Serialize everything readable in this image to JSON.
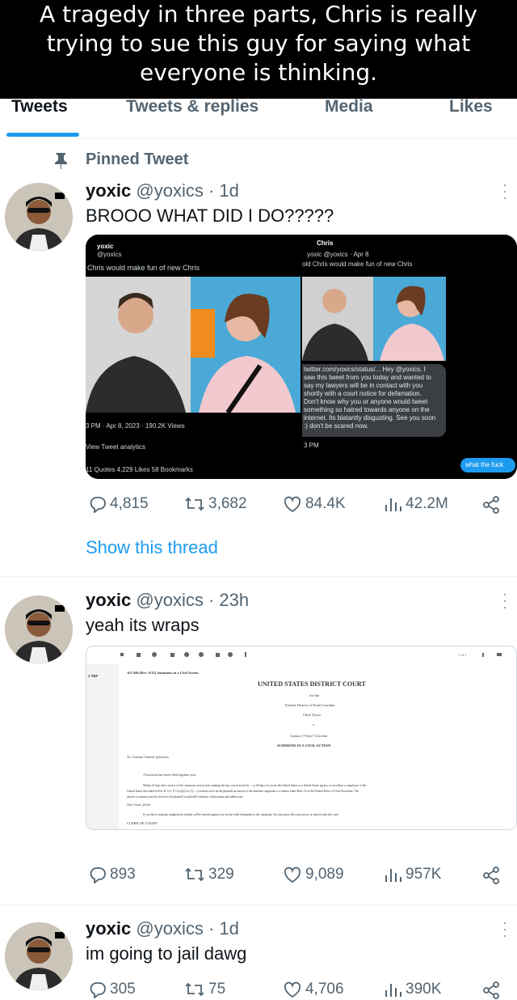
{
  "caption": {
    "lines": [
      "A tragedy in three parts, Chris is really",
      "trying to sue this guy for saying what",
      "everyone is thinking."
    ]
  },
  "tabs": [
    {
      "label": "Tweets",
      "active": true
    },
    {
      "label": "Tweets & replies",
      "active": false
    },
    {
      "label": "Media",
      "active": false
    },
    {
      "label": "Likes",
      "active": false
    }
  ],
  "pinned_label": "Pinned Tweet",
  "tweets": [
    {
      "name": "yoxic",
      "handle": "@yoxics",
      "time": "· 1d",
      "text": "BROOO WHAT DID I DO?????",
      "replies": "4,815",
      "retweets": "3,682",
      "likes": "84.4K",
      "views": "42.2M"
    },
    {
      "name": "yoxic",
      "handle": "@yoxics",
      "time": "· 23h",
      "text": "yeah its wraps",
      "replies": "893",
      "retweets": "329",
      "likes": "9,089",
      "views": "957K"
    },
    {
      "name": "yoxic",
      "handle": "@yoxics",
      "time": "· 1d",
      "text": "im going to jail dawg",
      "replies": "305",
      "retweets": "75",
      "likes": "4,706",
      "views": "390K"
    }
  ],
  "show_thread": "Show this thread",
  "media1": {
    "left": {
      "name": "yoxic",
      "handle": "@yoxics",
      "text": "Chris would make fun of new Chris",
      "meta": "3 PM · Apr 8, 2023 · 190.2K Views",
      "analytics": "View Tweet analytics",
      "stats": "11 Quotes   4,229 Likes   58 Bookmarks"
    },
    "right": {
      "name": "Chris",
      "quoted": "yoxic @yoxics · Apr 8",
      "quoted_text": "old Chris would make fun of new Chris",
      "link": "twitter.com/yoxics/status/... Hey @yoxics, I",
      "dm_lines": [
        "saw this tweet from you today and wanted to",
        "say my lawyers will be in contact with you",
        "shortly with a court notice for defamation.",
        "Don't know why you or anyone would tweet",
        "something so hatred towards anyone on the",
        "internet. Its blatantly disgusting. See you soon",
        ":) don't be scared now."
      ],
      "dm_time": "3 PM",
      "reply": "what the fuck"
    }
  },
  "media2": {
    "form_no": "AO 440 (Rev. 6/12) Summons in a Civil Action",
    "court": "UNITED STATES DISTRICT COURT",
    "for_the": "for the",
    "district": "Eastern District of North Carolina",
    "plaintiff": "Chris Tyson",
    "v": "v.",
    "defendant": "Connor (\"Yoxic\") Greene",
    "summons": "SUMMONS IN A CIVIL ACTION",
    "to": "To: Connor Greene  @yoxics",
    "lawsuit": "A lawsuit has been filed against you.",
    "body1": "Within 21 days after service of this summons on you (not counting the day you received it) — or 60 days if you are the United States or a United States agency, or an officer or employee of the",
    "body2": "United States described in Fed. R. Civ. P. 12 (a)(2) or (3) — you must serve on the plaintiff an answer to the attached complaint or a motion under Rule 12 of the Federal Rules of Civil Procedure. The",
    "body3": "answer or motion must be served on the plaintiff or plaintiff's attorney, whose name and address are:",
    "attorney": "Chris Tyson, @chris",
    "default": "If you fail to respond, judgment by default will be entered against you for the relief demanded in the complaint. You also must file your answer or motion with the court.",
    "clerk": "CLERK OF COURT",
    "page": "1 of 1",
    "sidebar_tag": "1 TEF"
  }
}
